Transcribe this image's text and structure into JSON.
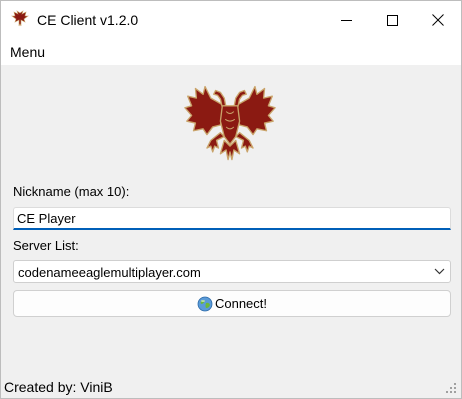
{
  "window": {
    "title": "CE Client v1.2.0",
    "app_icon": "eagle-icon",
    "controls": {
      "minimize": "minimize-icon",
      "maximize": "maximize-icon",
      "close": "close-icon"
    }
  },
  "menu": {
    "items": [
      {
        "label": "Menu"
      }
    ]
  },
  "emblem": {
    "icon": "double-headed-eagle-emblem"
  },
  "form": {
    "nickname_label": "Nickname (max 10):",
    "nickname_value": "CE Player",
    "server_label": "Server List:",
    "server_selected": "codenameeaglemultiplayer.com",
    "connect_label": "Connect!",
    "connect_icon": "globe-icon"
  },
  "footer": {
    "credit": "Created by: ViniB"
  },
  "colors": {
    "accent": "#005fb8",
    "eagle_red": "#8b1a12",
    "eagle_gold": "#c9a36a"
  }
}
